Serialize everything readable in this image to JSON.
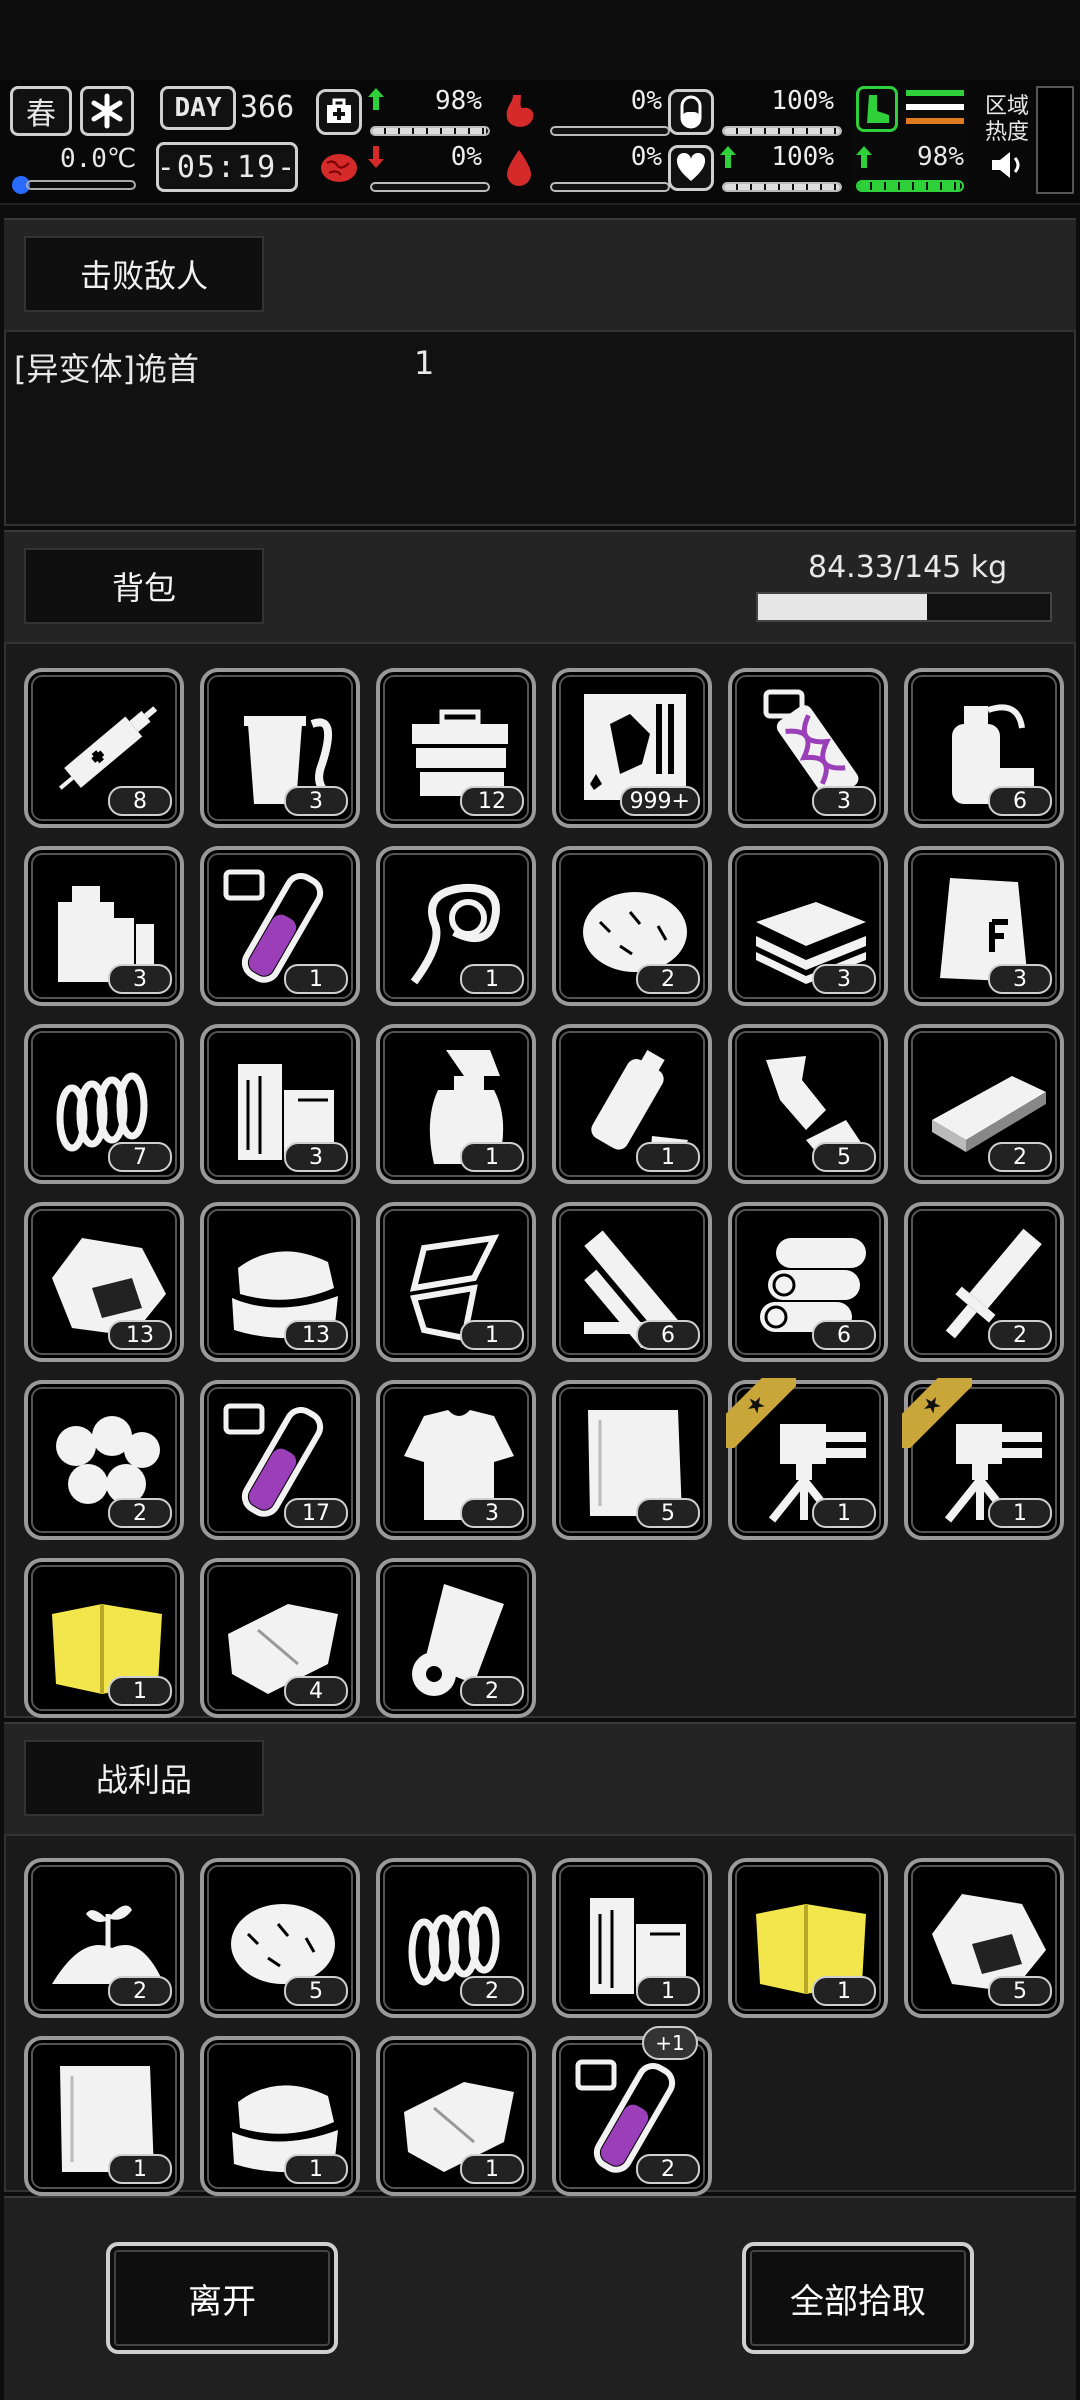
{
  "status": {
    "season": "春",
    "temperature": "0.0℃",
    "day_label": "DAY",
    "day_value": "366",
    "clock": "-05:19-",
    "stats": [
      {
        "id": "health",
        "value": "98%",
        "level": 0.98
      },
      {
        "id": "hunger",
        "value": "0%",
        "level": 0.0
      },
      {
        "id": "stamina",
        "value": "100%",
        "level": 1.0
      },
      {
        "id": "brain",
        "value": "0%",
        "level": 0.0
      },
      {
        "id": "blood",
        "value": "0%",
        "level": 0.0
      },
      {
        "id": "heart",
        "value": "100%",
        "level": 1.0
      },
      {
        "id": "leg",
        "value": "98%",
        "level": 0.98
      }
    ],
    "zone_heat": "区域\n热度"
  },
  "defeated": {
    "tab_label": "击败敌人",
    "enemy_name": "[异变体]诡首",
    "enemy_count": "1"
  },
  "backpack": {
    "tab_label": "背包",
    "weight_text": "84.33/145 kg",
    "weight_fraction": 0.58,
    "items": [
      {
        "icon": "syringe-icon",
        "count": "8"
      },
      {
        "icon": "drink-cup-icon",
        "count": "3"
      },
      {
        "icon": "toolbox-icon",
        "count": "12"
      },
      {
        "icon": "poster-icon",
        "count": "999+"
      },
      {
        "icon": "dna-vial-icon",
        "count": "3"
      },
      {
        "icon": "spray-bottle-icon",
        "count": "6"
      },
      {
        "icon": "chemical-jugs-icon",
        "count": "3"
      },
      {
        "icon": "purple-tube-icon",
        "count": "1"
      },
      {
        "icon": "rope-icon",
        "count": "1"
      },
      {
        "icon": "fiber-ball-icon",
        "count": "2"
      },
      {
        "icon": "plank-stack-icon",
        "count": "3"
      },
      {
        "icon": "sack-icon",
        "count": "3"
      },
      {
        "icon": "spring-icon",
        "count": "7"
      },
      {
        "icon": "wood-blocks-icon",
        "count": "3"
      },
      {
        "icon": "spray-trigger-icon",
        "count": "1"
      },
      {
        "icon": "plastic-bottle-icon",
        "count": "1"
      },
      {
        "icon": "scrap-parts-icon",
        "count": "5"
      },
      {
        "icon": "board-icon",
        "count": "2"
      },
      {
        "icon": "ore-rock-icon",
        "count": "13"
      },
      {
        "icon": "cloth-pile-icon",
        "count": "13"
      },
      {
        "icon": "paper-scraps-icon",
        "count": "1"
      },
      {
        "icon": "lumber-icon",
        "count": "6"
      },
      {
        "icon": "logs-icon",
        "count": "6"
      },
      {
        "icon": "sword-icon",
        "count": "2"
      },
      {
        "icon": "cotton-balls-icon",
        "count": "2"
      },
      {
        "icon": "purple-tube-icon",
        "count": "17"
      },
      {
        "icon": "torn-shirt-icon",
        "count": "3"
      },
      {
        "icon": "cloth-sheet-icon",
        "count": "5"
      },
      {
        "icon": "turret-icon",
        "count": "1",
        "ribbon": true
      },
      {
        "icon": "turret-icon",
        "count": "1",
        "ribbon": true
      },
      {
        "icon": "yellow-cloth-icon",
        "count": "1"
      },
      {
        "icon": "folded-cloth-icon",
        "count": "4"
      },
      {
        "icon": "fabric-roll-icon",
        "count": "2"
      }
    ]
  },
  "loot": {
    "tab_label": "战利品",
    "items": [
      {
        "icon": "sprout-soil-icon",
        "count": "2"
      },
      {
        "icon": "fiber-ball-icon",
        "count": "5"
      },
      {
        "icon": "spring-icon",
        "count": "2"
      },
      {
        "icon": "wood-blocks-icon",
        "count": "1"
      },
      {
        "icon": "yellow-cloth-icon",
        "count": "1"
      },
      {
        "icon": "ore-rock-icon",
        "count": "5"
      },
      {
        "icon": "cloth-sheet-icon",
        "count": "1"
      },
      {
        "icon": "cloth-pile-icon",
        "count": "1"
      },
      {
        "icon": "folded-cloth-icon",
        "count": "1"
      },
      {
        "icon": "purple-tube-icon",
        "count": "2",
        "badge": "+1"
      }
    ]
  },
  "actions": {
    "leave_label": "离开",
    "pickup_all_label": "全部拾取"
  },
  "colors": {
    "accent_green": "#2fd13a",
    "accent_red": "#d42a2a",
    "gold": "#c9a63a",
    "purple": "#9b3fb8"
  }
}
